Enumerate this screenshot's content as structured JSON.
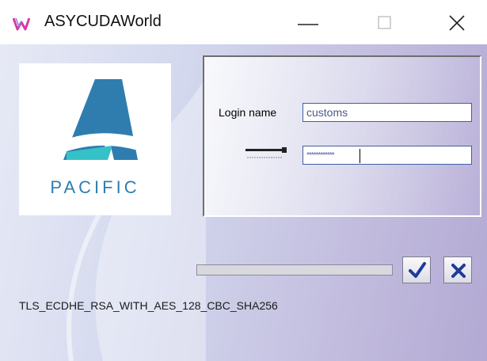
{
  "window": {
    "title": "ASYCUDAWorld",
    "app_icon": "asycuda-w-icon",
    "controls": {
      "minimize_icon": "minimize-icon",
      "maximize_icon": "maximize-icon",
      "close_icon": "close-icon"
    }
  },
  "logo": {
    "text": "PACIFIC",
    "icon": "pacific-a-logo",
    "colors": {
      "primary": "#2e7dae",
      "secondary": "#35c1c8"
    }
  },
  "login": {
    "login_label": "Login name",
    "login_value": "customs",
    "password_icon": "password-key-icon",
    "password_value": "************"
  },
  "progress": {
    "fraction": 0
  },
  "actions": {
    "ok_icon": "checkmark-icon",
    "cancel_icon": "cancel-x-icon",
    "accent": "#1e3a9a"
  },
  "status": {
    "tls": "TLS_ECDHE_RSA_WITH_AES_128_CBC_SHA256"
  }
}
